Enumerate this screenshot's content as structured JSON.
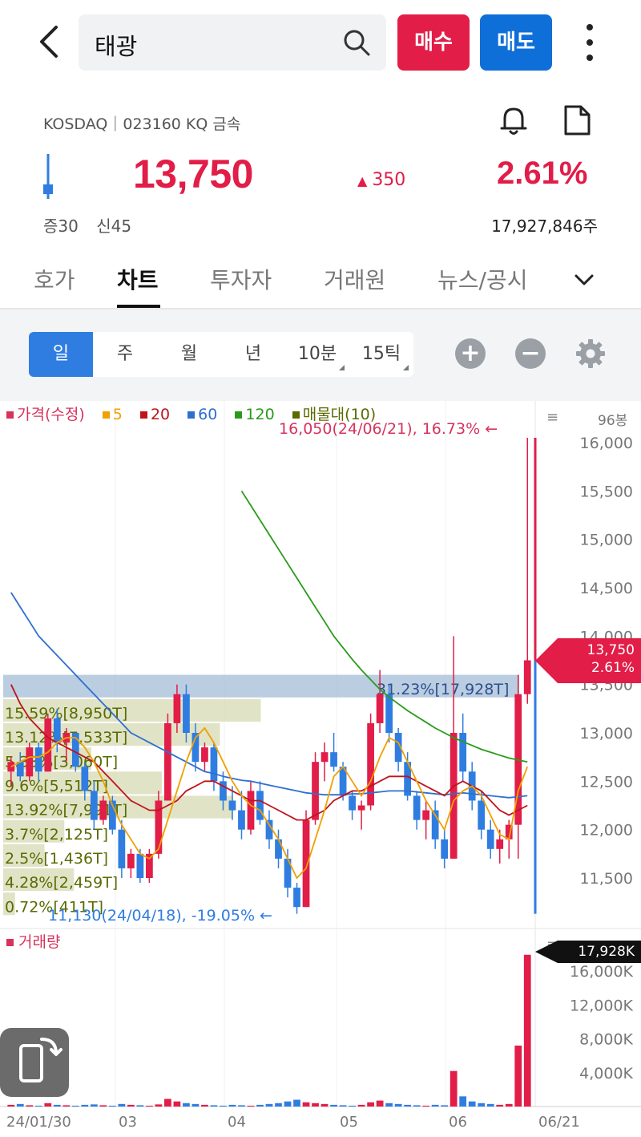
{
  "header": {
    "search_value": "태광",
    "buy_label": "매수",
    "sell_label": "매도"
  },
  "info": {
    "market_line": "KOSDAQ｜023160 KQ 금속",
    "price": "13,750",
    "change": "350",
    "change_pct": "2.61%",
    "margin_1": "증30",
    "margin_2": "신45",
    "volume": "17,927,846주"
  },
  "tabs": [
    "호가",
    "차트",
    "투자자",
    "거래원",
    "뉴스/공시"
  ],
  "period_options": [
    "일",
    "주",
    "월",
    "년",
    "10분",
    "15틱"
  ],
  "chart": {
    "legend": {
      "price": "가격(수정)",
      "ma5": "5",
      "ma20": "20",
      "ma60": "60",
      "ma120": "120",
      "volume_profile": "매물대(10)"
    },
    "period_count": "96봉",
    "high_note": "16,050(24/06/21), 16.73% ←",
    "low_note": "11,130(24/04/18), -19.05% ←",
    "current_price_tag": "13,750",
    "current_pct_tag": "2.61%",
    "volume_label": "거래량",
    "volume_tag": "17,928K",
    "colors": {
      "up": "#e11d48",
      "down": "#2f7de1",
      "ma5": "#f0a000",
      "ma20": "#c0141c",
      "ma60": "#2e6fd0",
      "ma120": "#2a9a1a",
      "profile": "#5a6b00"
    }
  },
  "chart_data": {
    "type": "candlestick",
    "y_ticks": [
      "16,000",
      "15,500",
      "15,000",
      "14,500",
      "14,000",
      "13,500",
      "13,000",
      "12,500",
      "12,000",
      "11,500"
    ],
    "ylim": [
      11100,
      16100
    ],
    "x_ticks": [
      "24/01/30",
      "03",
      "04",
      "05",
      "06",
      "06/21"
    ],
    "volume_ticks": [
      "16,000K",
      "12,000K",
      "8,000K",
      "4,000K"
    ],
    "volume_ylim": [
      0,
      18000
    ],
    "volume_profile": [
      {
        "label": "31.23%[17,928T]",
        "price": 13550,
        "pct": 31.23
      },
      {
        "label": "15.59%[8,950T]",
        "price": 13300,
        "pct": 15.59
      },
      {
        "label": "13.12%[7,533T]",
        "price": 13050,
        "pct": 13.12
      },
      {
        "label": "5.33%[3,060T]",
        "price": 12800,
        "pct": 5.33
      },
      {
        "label": "9.6%[5,512T]",
        "price": 12550,
        "pct": 9.6
      },
      {
        "label": "13.92%[7,991T]",
        "price": 12300,
        "pct": 13.92
      },
      {
        "label": "3.7%[2,125T]",
        "price": 12050,
        "pct": 3.7
      },
      {
        "label": "2.5%[1,436T]",
        "price": 11800,
        "pct": 2.5
      },
      {
        "label": "4.28%[2,459T]",
        "price": 11550,
        "pct": 4.28
      },
      {
        "label": "0.72%[411T]",
        "price": 11300,
        "pct": 0.72
      }
    ],
    "candles": [
      [
        12600,
        12750,
        12450,
        12700
      ],
      [
        12700,
        12800,
        12500,
        12550
      ],
      [
        12550,
        12900,
        12500,
        12850
      ],
      [
        12850,
        12900,
        12500,
        12600
      ],
      [
        12600,
        13200,
        12600,
        13150
      ],
      [
        13150,
        13250,
        12800,
        12900
      ],
      [
        12900,
        13050,
        12700,
        13000
      ],
      [
        13000,
        13000,
        12600,
        12650
      ],
      [
        12650,
        12700,
        12300,
        12400
      ],
      [
        12400,
        12500,
        12000,
        12100
      ],
      [
        12100,
        12350,
        12050,
        12300
      ],
      [
        12300,
        12350,
        11950,
        12000
      ],
      [
        12000,
        12100,
        11500,
        11600
      ],
      [
        11600,
        11800,
        11500,
        11750
      ],
      [
        11750,
        11800,
        11450,
        11500
      ],
      [
        11500,
        11800,
        11450,
        11750
      ],
      [
        11750,
        12400,
        11700,
        12300
      ],
      [
        12300,
        13200,
        12300,
        13100
      ],
      [
        13100,
        13500,
        13000,
        13400
      ],
      [
        13400,
        13500,
        12900,
        13000
      ],
      [
        13000,
        13100,
        12600,
        12700
      ],
      [
        12700,
        12900,
        12600,
        12850
      ],
      [
        12850,
        12900,
        12400,
        12500
      ],
      [
        12500,
        12600,
        12200,
        12300
      ],
      [
        12300,
        12450,
        12100,
        12200
      ],
      [
        12200,
        12400,
        11900,
        12000
      ],
      [
        12000,
        12500,
        11950,
        12400
      ],
      [
        12400,
        12500,
        12050,
        12100
      ],
      [
        12100,
        12200,
        11800,
        11900
      ],
      [
        11900,
        12000,
        11600,
        11700
      ],
      [
        11700,
        11800,
        11300,
        11400
      ],
      [
        11400,
        11450,
        11130,
        11200
      ],
      [
        11200,
        12200,
        11200,
        12100
      ],
      [
        12100,
        12800,
        12050,
        12700
      ],
      [
        12700,
        12900,
        12500,
        12800
      ],
      [
        12800,
        13000,
        12600,
        12650
      ],
      [
        12650,
        12700,
        12300,
        12350
      ],
      [
        12350,
        12400,
        12100,
        12200
      ],
      [
        12200,
        12300,
        12000,
        12250
      ],
      [
        12250,
        13200,
        12200,
        13100
      ],
      [
        13100,
        13650,
        13000,
        13400
      ],
      [
        13400,
        13500,
        12900,
        13000
      ],
      [
        13000,
        13050,
        12600,
        12700
      ],
      [
        12700,
        12800,
        12300,
        12350
      ],
      [
        12350,
        12400,
        12000,
        12100
      ],
      [
        12100,
        12300,
        11900,
        12200
      ],
      [
        12200,
        12300,
        11800,
        11900
      ],
      [
        11900,
        12000,
        11600,
        11700
      ],
      [
        11700,
        14000,
        11700,
        13000
      ],
      [
        13000,
        13200,
        12500,
        12600
      ],
      [
        12600,
        12700,
        12200,
        12300
      ],
      [
        12300,
        12400,
        11900,
        12000
      ],
      [
        12000,
        12100,
        11700,
        11800
      ],
      [
        11800,
        12000,
        11650,
        11900
      ],
      [
        11900,
        12100,
        11700,
        12050
      ],
      [
        12050,
        13600,
        11700,
        13400
      ],
      [
        13400,
        16050,
        13300,
        13750
      ]
    ],
    "ma5": [
      12650,
      12700,
      12750,
      12750,
      12800,
      12900,
      12950,
      12950,
      12850,
      12700,
      12500,
      12250,
      12050,
      11900,
      11750,
      11700,
      11800,
      12100,
      12400,
      12700,
      12950,
      13050,
      12900,
      12700,
      12500,
      12350,
      12250,
      12200,
      12050,
      11900,
      11700,
      11500,
      11600,
      11900,
      12200,
      12550,
      12650,
      12500,
      12350,
      12500,
      12750,
      12950,
      12900,
      12700,
      12500,
      12300,
      12150,
      12000,
      12300,
      12400,
      12450,
      12350,
      12150,
      11950,
      11900,
      12400,
      12650
    ],
    "ma20": [
      13500,
      13300,
      13150,
      13050,
      12950,
      12900,
      12850,
      12800,
      12750,
      12700,
      12600,
      12500,
      12400,
      12300,
      12250,
      12200,
      12200,
      12250,
      12300,
      12400,
      12450,
      12500,
      12500,
      12450,
      12400,
      12350,
      12300,
      12300,
      12250,
      12200,
      12150,
      12100,
      12100,
      12150,
      12200,
      12300,
      12350,
      12400,
      12400,
      12450,
      12500,
      12550,
      12550,
      12550,
      12500,
      12450,
      12400,
      12350,
      12450,
      12500,
      12450,
      12400,
      12300,
      12200,
      12150,
      12200,
      12250
    ],
    "ma60": [
      14450,
      14300,
      14150,
      14000,
      13900,
      13800,
      13700,
      13600,
      13500,
      13400,
      13300,
      13200,
      13100,
      13000,
      12950,
      12900,
      12850,
      12800,
      12750,
      12700,
      12650,
      12600,
      12580,
      12550,
      12530,
      12510,
      12500,
      12480,
      12460,
      12440,
      12420,
      12400,
      12380,
      12370,
      12360,
      12360,
      12360,
      12370,
      12370,
      12380,
      12390,
      12400,
      12400,
      12400,
      12390,
      12380,
      12370,
      12360,
      12370,
      12380,
      12370,
      12360,
      12350,
      12340,
      12330,
      12340,
      12350
    ],
    "ma120": [
      15500,
      15350,
      15200,
      15050,
      14900,
      14750,
      14600,
      14450,
      14300,
      14150,
      14000,
      13880,
      13760,
      13650,
      13550,
      13450,
      13370,
      13300,
      13230,
      13170,
      13110,
      13050,
      13000,
      12950,
      12910,
      12870,
      12830,
      12800,
      12770,
      12740,
      12720,
      12700
    ],
    "volume": [
      200,
      300,
      150,
      100,
      400,
      200,
      150,
      100,
      200,
      250,
      150,
      100,
      300,
      200,
      150,
      100,
      250,
      900,
      600,
      400,
      300,
      200,
      150,
      100,
      200,
      150,
      100,
      200,
      300,
      400,
      600,
      800,
      500,
      400,
      300,
      200,
      150,
      100,
      200,
      500,
      700,
      400,
      300,
      200,
      150,
      100,
      200,
      150,
      4200,
      1200,
      600,
      400,
      300,
      200,
      300,
      7200,
      17928
    ]
  }
}
